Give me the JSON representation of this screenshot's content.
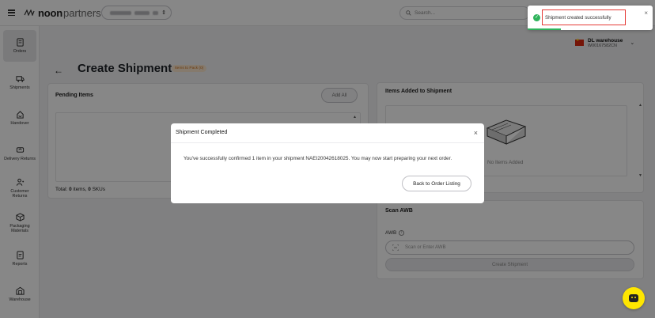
{
  "header": {
    "brand_bold": "noon",
    "brand_light": "partners",
    "search_placeholder": "Search..."
  },
  "sidebar": {
    "items": [
      {
        "label": "Orders",
        "icon": "orders-icon"
      },
      {
        "label": "Shipments",
        "icon": "truck-icon"
      },
      {
        "label": "Handover",
        "icon": "handover-icon"
      },
      {
        "label": "Delivery Returns",
        "icon": "delivery-returns-icon"
      },
      {
        "label": "Customer Returns",
        "icon": "customer-returns-icon"
      },
      {
        "label": "Packaging Materials",
        "icon": "packaging-icon"
      },
      {
        "label": "Reports",
        "icon": "reports-icon"
      },
      {
        "label": "Warehouse",
        "icon": "warehouse-icon"
      }
    ]
  },
  "page": {
    "title": "Create Shipment",
    "status_badge": "Items to Pack (0)"
  },
  "warehouse": {
    "name": "DL warehouse",
    "code": "W00167582CN"
  },
  "pending": {
    "title": "Pending Items",
    "add_all": "Add All",
    "total_prefix": "Total: ",
    "items_count": "0",
    "items_label": " items, ",
    "skus_count": "0",
    "skus_label": " SKUs"
  },
  "added": {
    "title": "Items Added to Shipment",
    "empty": "No Items Added"
  },
  "awb": {
    "title": "Scan AWB",
    "label": "AWB",
    "placeholder": "Scan or Enter AWB",
    "create_button": "Create Shipment"
  },
  "modal": {
    "title": "Shipment Completed",
    "message": "You've successfully confirmed 1 item in your shipment NAEI20042618025. You may now start preparing your next order.",
    "button": "Back to Order Listing"
  },
  "toast": {
    "message": "Shipment created successfully"
  },
  "colors": {
    "accent_yellow": "#fee600",
    "success_green": "#2eb35b",
    "highlight_red": "#e53935",
    "badge_orange": "#c96d17"
  }
}
